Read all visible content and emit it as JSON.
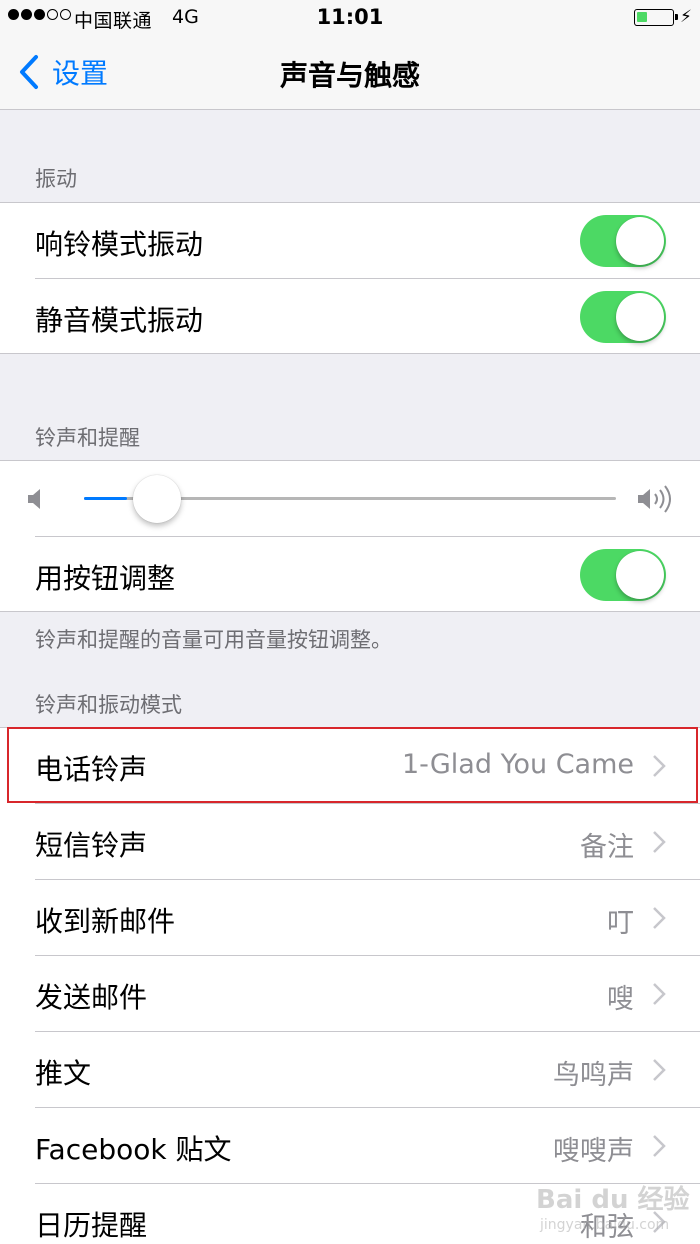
{
  "status_bar": {
    "carrier": "中国联通",
    "network": "4G",
    "time": "11:01",
    "battery_level": 0.3,
    "signal_bars_filled": 3,
    "signal_bars_total": 5
  },
  "nav": {
    "back_label": "设置",
    "title": "声音与触感"
  },
  "vibration": {
    "header": "振动",
    "items": [
      {
        "label": "响铃模式振动",
        "on": true
      },
      {
        "label": "静音模式振动",
        "on": true
      }
    ]
  },
  "ringer": {
    "header": "铃声和提醒",
    "volume_level": 0.08,
    "button_adjust": {
      "label": "用按钮调整",
      "on": true
    },
    "footnote": "铃声和提醒的音量可用音量按钮调整。"
  },
  "patterns": {
    "header": "铃声和振动模式",
    "items": [
      {
        "label": "电话铃声",
        "value": "1-Glad You Came"
      },
      {
        "label": "短信铃声",
        "value": "备注"
      },
      {
        "label": "收到新邮件",
        "value": "叮"
      },
      {
        "label": "发送邮件",
        "value": "嗖"
      },
      {
        "label": "推文",
        "value": "鸟鸣声"
      },
      {
        "label": "Facebook 贴文",
        "value": "嗖嗖声"
      },
      {
        "label": "日历提醒",
        "value": "和弦"
      }
    ]
  },
  "watermark": {
    "main": "Bai du 经验",
    "sub": "jingyan.baidu.com"
  },
  "colors": {
    "accent": "#007aff",
    "toggle_on": "#4cd964",
    "highlight": "#d8262b",
    "background": "#efeff4",
    "secondary_text": "#8e8e93"
  },
  "icons": {
    "back": "chevron-left-icon",
    "disclosure": "chevron-right-icon",
    "volume_low": "speaker-low-icon",
    "volume_high": "speaker-high-icon",
    "charging": "bolt-icon"
  }
}
